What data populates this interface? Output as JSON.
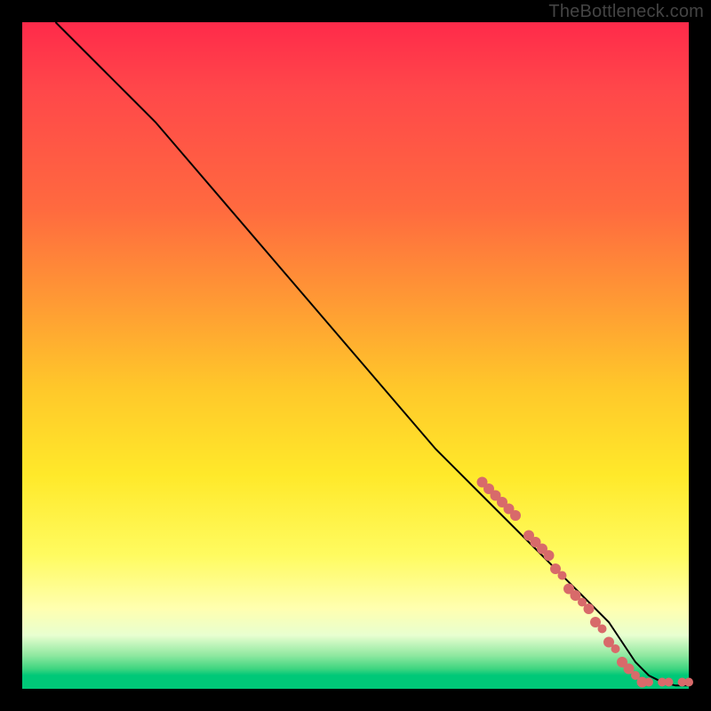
{
  "watermark": "TheBottleneck.com",
  "colors": {
    "point_fill": "#d86a6a",
    "line_stroke": "#000000",
    "bg_top": "#ff2a4a",
    "bg_mid": "#ffe92a",
    "bg_bottom": "#00c878",
    "page_bg": "#000000",
    "watermark_color": "#444444"
  },
  "chart_data": {
    "type": "line",
    "title": "",
    "xlabel": "",
    "ylabel": "",
    "xlim": [
      0,
      100
    ],
    "ylim": [
      0,
      100
    ],
    "grid": false,
    "legend": false,
    "series": [
      {
        "name": "curve",
        "style": "line",
        "x": [
          5,
          8,
          12,
          16,
          20,
          26,
          32,
          38,
          44,
          50,
          56,
          62,
          68,
          74,
          80,
          84,
          88,
          90,
          92,
          94,
          96,
          98,
          100
        ],
        "y": [
          100,
          97,
          93,
          89,
          85,
          78,
          71,
          64,
          57,
          50,
          43,
          36,
          30,
          24,
          18,
          14,
          10,
          7,
          4,
          2,
          1,
          0.5,
          0.5
        ]
      },
      {
        "name": "highlighted-points",
        "style": "scatter",
        "points": [
          {
            "x": 69,
            "y": 31,
            "r": 6
          },
          {
            "x": 70,
            "y": 30,
            "r": 6
          },
          {
            "x": 71,
            "y": 29,
            "r": 6
          },
          {
            "x": 72,
            "y": 28,
            "r": 6
          },
          {
            "x": 73,
            "y": 27,
            "r": 6
          },
          {
            "x": 74,
            "y": 26,
            "r": 6
          },
          {
            "x": 76,
            "y": 23,
            "r": 6
          },
          {
            "x": 77,
            "y": 22,
            "r": 6
          },
          {
            "x": 78,
            "y": 21,
            "r": 6
          },
          {
            "x": 79,
            "y": 20,
            "r": 6
          },
          {
            "x": 80,
            "y": 18,
            "r": 6
          },
          {
            "x": 81,
            "y": 17,
            "r": 5
          },
          {
            "x": 82,
            "y": 15,
            "r": 6
          },
          {
            "x": 83,
            "y": 14,
            "r": 6
          },
          {
            "x": 84,
            "y": 13,
            "r": 5
          },
          {
            "x": 85,
            "y": 12,
            "r": 6
          },
          {
            "x": 86,
            "y": 10,
            "r": 6
          },
          {
            "x": 87,
            "y": 9,
            "r": 5
          },
          {
            "x": 88,
            "y": 7,
            "r": 6
          },
          {
            "x": 89,
            "y": 6,
            "r": 5
          },
          {
            "x": 90,
            "y": 4,
            "r": 6
          },
          {
            "x": 91,
            "y": 3,
            "r": 6
          },
          {
            "x": 92,
            "y": 2,
            "r": 5
          },
          {
            "x": 93,
            "y": 1,
            "r": 6
          },
          {
            "x": 94,
            "y": 1,
            "r": 5
          },
          {
            "x": 96,
            "y": 1,
            "r": 5
          },
          {
            "x": 97,
            "y": 1,
            "r": 5
          },
          {
            "x": 99,
            "y": 1,
            "r": 5
          },
          {
            "x": 100,
            "y": 1,
            "r": 5
          }
        ]
      }
    ]
  }
}
